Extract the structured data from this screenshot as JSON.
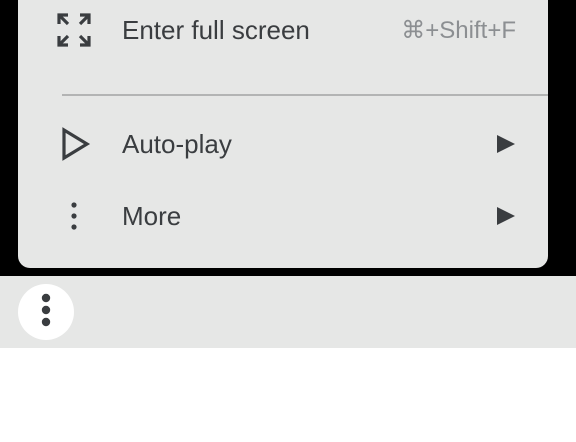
{
  "menu": {
    "items": [
      {
        "label": "Enter full screen",
        "shortcut": "⌘+Shift+F",
        "icon": "fullscreen-icon"
      },
      {
        "label": "Auto-play",
        "icon": "play-outline-icon",
        "submenu_icon": "submenu-arrow-icon"
      },
      {
        "label": "More",
        "icon": "vertical-dots-icon",
        "submenu_icon": "submenu-arrow-icon"
      }
    ]
  },
  "toolbar": {
    "more_button_icon": "more-vertical-icon"
  },
  "colors": {
    "menu_background": "#e6e7e6",
    "text": "#3a3d40",
    "shortcut_text": "#8c8f92",
    "divider": "#b3b4b4",
    "video_background": "#000000"
  }
}
